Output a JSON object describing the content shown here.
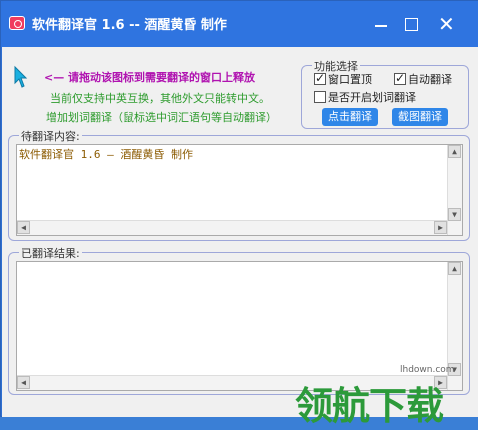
{
  "window": {
    "title": "软件翻译官 1.6 -- 酒醒黄昏 制作"
  },
  "hints": {
    "drag": "<— 请拖动该图标到需要翻译的窗口上释放",
    "lang": "当前仅支持中英互换，其他外文只能转中文。",
    "feature": "增加划词翻译（鼠标选中词汇语句等自动翻译）"
  },
  "features": {
    "legend": "功能选择",
    "topmost": {
      "label": "窗口置顶",
      "checked": true
    },
    "auto_translate": {
      "label": "自动翻译",
      "checked": true
    },
    "word_select": {
      "label": "是否开启划词翻译",
      "checked": false
    },
    "click_translate_label": "点击翻译",
    "screenshot_translate_label": "截图翻译"
  },
  "source": {
    "legend": "待翻译内容:",
    "value": "软件翻译官 1.6 — 酒醒黄昏 制作"
  },
  "result": {
    "legend": "已翻译结果:",
    "value": ""
  },
  "watermark": {
    "url": "lhdown.com",
    "logo": "领航下载"
  },
  "colors": {
    "titlebar": "#2f74e0",
    "hint_purple": "#b013b0",
    "hint_green": "#2d9b2d",
    "button_blue": "#2f86e8"
  }
}
